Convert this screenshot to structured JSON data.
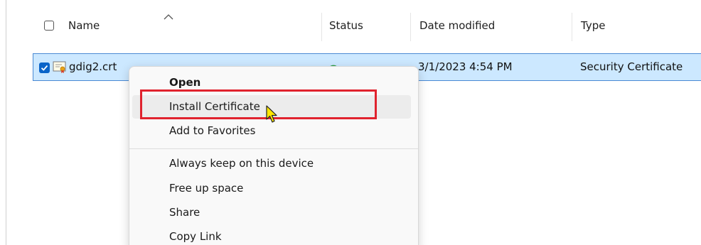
{
  "header": {
    "columns": {
      "name": "Name",
      "status": "Status",
      "date_modified": "Date modified",
      "type": "Type"
    }
  },
  "file_row": {
    "name": "gdig2.crt",
    "date_modified": "3/1/2023 4:54 PM",
    "type": "Security Certificate",
    "selected": true
  },
  "context_menu": {
    "items": [
      {
        "label": "Open"
      },
      {
        "label": "Install Certificate"
      },
      {
        "label": "Add to Favorites"
      },
      {
        "label": "Always keep on this device"
      },
      {
        "label": "Free up space"
      },
      {
        "label": "Share"
      },
      {
        "label": "Copy Link"
      }
    ]
  },
  "colors": {
    "selection_bg": "#cce8ff",
    "selection_border": "#4a8ad4",
    "checkbox_accent": "#0a64c8",
    "annotation_red": "#e0232e"
  },
  "icons": {
    "file": "certificate-file-icon",
    "status": "sync-status-icon",
    "sort": "sort-ascending-icon",
    "cursor": "mouse-pointer-icon"
  }
}
